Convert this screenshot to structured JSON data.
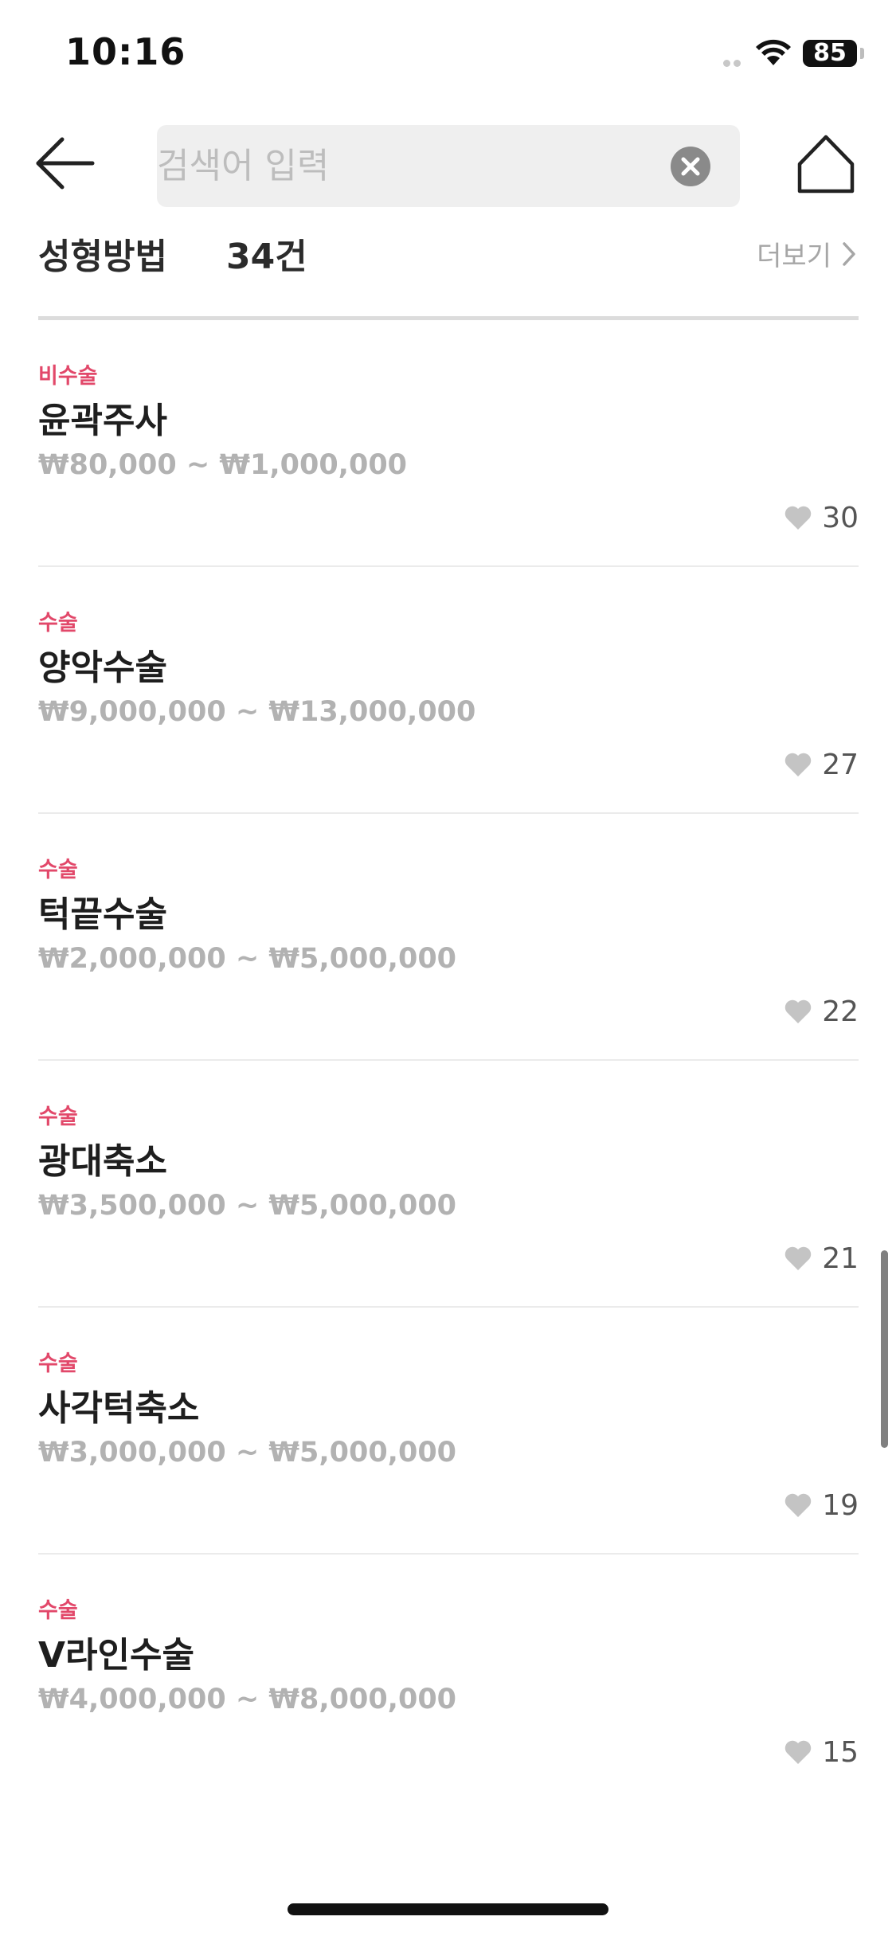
{
  "status_bar": {
    "time": "10:16",
    "battery": "85"
  },
  "header": {
    "search_placeholder": "검색어 입력",
    "search_value": ""
  },
  "section": {
    "title": "성형방법",
    "count": "34건",
    "more_label": "더보기"
  },
  "items": [
    {
      "tag": "비수술",
      "name": "윤곽주사",
      "price": "₩80,000 ~ ₩1,000,000",
      "likes": "30"
    },
    {
      "tag": "수술",
      "name": "양악수술",
      "price": "₩9,000,000 ~ ₩13,000,000",
      "likes": "27"
    },
    {
      "tag": "수술",
      "name": "턱끝수술",
      "price": "₩2,000,000 ~ ₩5,000,000",
      "likes": "22"
    },
    {
      "tag": "수술",
      "name": "광대축소",
      "price": "₩3,500,000 ~ ₩5,000,000",
      "likes": "21"
    },
    {
      "tag": "수술",
      "name": "사각턱축소",
      "price": "₩3,000,000 ~ ₩5,000,000",
      "likes": "19"
    },
    {
      "tag": "수술",
      "name": "V라인수술",
      "price": "₩4,000,000 ~ ₩8,000,000",
      "likes": "15"
    }
  ],
  "colors": {
    "accent": "#e2486a",
    "price": "#b2b2b2",
    "heart": "#c4c4c4"
  }
}
